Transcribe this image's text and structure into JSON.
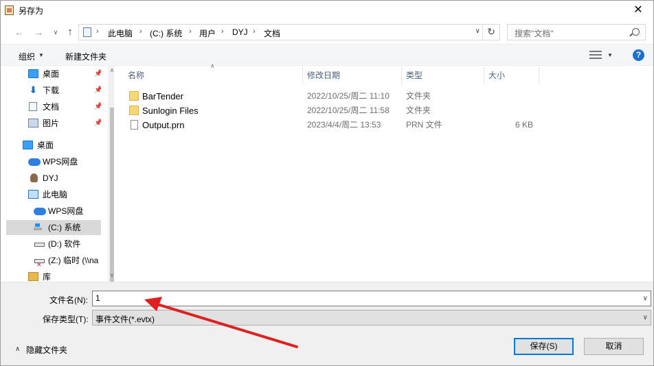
{
  "window": {
    "title": "另存为",
    "close_glyph": "✕"
  },
  "navigation": {
    "back_glyph": "←",
    "forward_glyph": "→",
    "recent_glyph": "∨",
    "up_glyph": "↑"
  },
  "address": {
    "segments": [
      "此电脑",
      "(C:) 系统",
      "用户",
      "DYJ",
      "文档"
    ],
    "separator": "›",
    "dropdown_glyph": "∨",
    "refresh_glyph": "↻"
  },
  "search": {
    "placeholder": "搜索\"文档\""
  },
  "toolbar": {
    "organize_label": "组织",
    "organize_caret": "▼",
    "new_folder_label": "新建文件夹",
    "view_caret": "▼",
    "help_glyph": "?"
  },
  "nav_pane": {
    "pin_glyph": "📌",
    "items": [
      {
        "label": "桌面",
        "icon": "desktop-icon",
        "pinned": true
      },
      {
        "label": "下载",
        "icon": "download-icon",
        "pinned": true
      },
      {
        "label": "文档",
        "icon": "document-icon",
        "pinned": true
      },
      {
        "label": "图片",
        "icon": "picture-icon",
        "pinned": true
      },
      {
        "label": "桌面",
        "icon": "desktop-icon",
        "pinned": false
      },
      {
        "label": "WPS网盘",
        "icon": "cloud-icon",
        "pinned": false
      },
      {
        "label": "DYJ",
        "icon": "user-icon",
        "pinned": false
      },
      {
        "label": "此电脑",
        "icon": "computer-icon",
        "pinned": false
      },
      {
        "label": "WPS网盘",
        "icon": "cloud-icon",
        "pinned": false
      },
      {
        "label": "(C:) 系统",
        "icon": "system-drive-icon",
        "pinned": false,
        "selected": true
      },
      {
        "label": "(D:) 软件",
        "icon": "drive-icon",
        "pinned": false
      },
      {
        "label": "(Z:) 临时 (\\\\na",
        "icon": "network-drive-icon",
        "pinned": false
      },
      {
        "label": "库",
        "icon": "library-icon",
        "pinned": false
      }
    ],
    "scroll_up_glyph": "∧",
    "scroll_down_glyph": "∨"
  },
  "file_list": {
    "columns": [
      "名称",
      "修改日期",
      "类型",
      "大小"
    ],
    "sort_glyph": "∧",
    "rows": [
      {
        "name": "BarTender",
        "date": "2022/10/25/周二 11:10",
        "type": "文件夹",
        "size": "",
        "icon": "folder-icon"
      },
      {
        "name": "Sunlogin Files",
        "date": "2022/10/25/周二 11:58",
        "type": "文件夹",
        "size": "",
        "icon": "folder-icon"
      },
      {
        "name": "Output.prn",
        "date": "2023/4/4/周二 13:53",
        "type": "PRN 文件",
        "size": "6 KB",
        "icon": "file-icon"
      }
    ]
  },
  "save_form": {
    "filename_label": "文件名(N):",
    "filename_value": "1",
    "filetype_label": "保存类型(T):",
    "filetype_value": "事件文件(*.evtx)",
    "dropdown_glyph": "∨"
  },
  "footer": {
    "hide_folders_caret": "∧",
    "hide_folders_label": "隐藏文件夹",
    "save_button": "保存(S)",
    "cancel_button": "取消"
  },
  "colors": {
    "annotation_arrow": "#e02020",
    "accent": "#0078d7",
    "help": "#1e6fd3",
    "folder": "#f8d775"
  }
}
